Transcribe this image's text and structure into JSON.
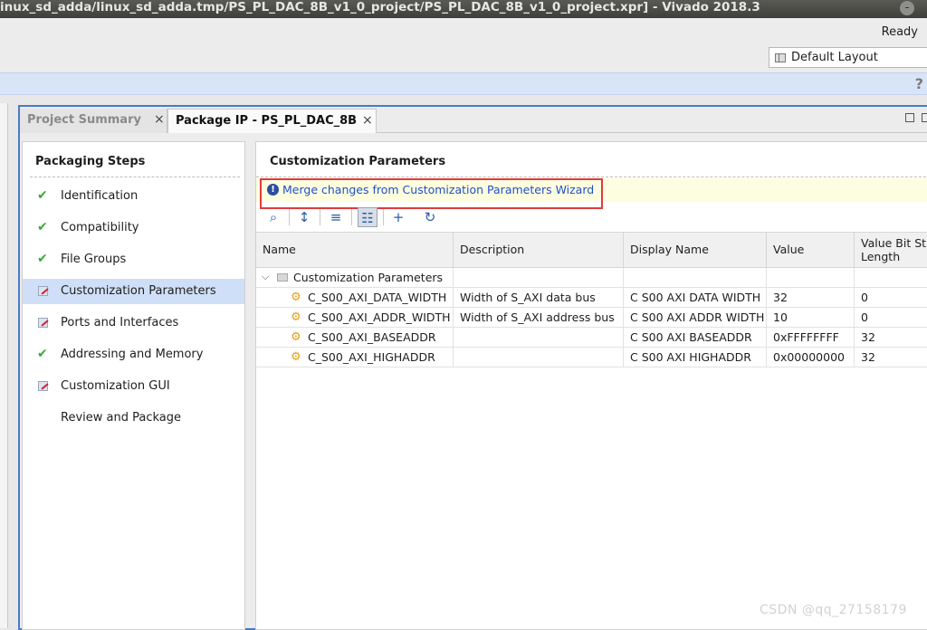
{
  "window": {
    "title": "inux_sd_adda/linux_sd_adda.tmp/PS_PL_DAC_8B_v1_0_project/PS_PL_DAC_8B_v1_0_project.xpr] - Vivado 2018.3"
  },
  "toolbar": {
    "status": "Ready",
    "layout_select": "Default Layout",
    "help_label": "?"
  },
  "tabs": [
    {
      "label": "Project Summary",
      "close": "×"
    },
    {
      "label": "Package IP - PS_PL_DAC_8B",
      "close": "×"
    }
  ],
  "packaging_steps": {
    "title": "Packaging Steps",
    "items": [
      {
        "label": "Identification",
        "status": "complete",
        "icon": "check-icon"
      },
      {
        "label": "Compatibility",
        "status": "complete",
        "icon": "check-icon"
      },
      {
        "label": "File Groups",
        "status": "complete",
        "icon": "check-icon"
      },
      {
        "label": "Customization Parameters",
        "status": "edited",
        "icon": "edit-icon",
        "selected": true
      },
      {
        "label": "Ports and Interfaces",
        "status": "edited",
        "icon": "edit-icon"
      },
      {
        "label": "Addressing and Memory",
        "status": "complete",
        "icon": "check-icon"
      },
      {
        "label": "Customization GUI",
        "status": "edited",
        "icon": "edit-icon"
      },
      {
        "label": "Review and Package",
        "status": "none",
        "icon": ""
      }
    ]
  },
  "customization": {
    "title": "Customization Parameters",
    "info_icon": "!",
    "merge_link": "Merge changes from Customization Parameters Wizard",
    "toolbar_icons": [
      "search-icon",
      "collapse-all-icon",
      "expand-all-icon",
      "hierarchy-icon",
      "add-icon",
      "refresh-icon"
    ],
    "table": {
      "columns": [
        "Name",
        "Description",
        "Display Name",
        "Value",
        "Value Bit St Length"
      ],
      "columns_split": {
        "len_line1": "Value Bit St",
        "len_line2": "Length"
      },
      "group": "Customization Parameters",
      "rows": [
        {
          "name": "C_S00_AXI_DATA_WIDTH",
          "description": "Width of S_AXI data bus",
          "display_name": "C S00 AXI DATA WIDTH",
          "value": "32",
          "length": "0"
        },
        {
          "name": "C_S00_AXI_ADDR_WIDTH",
          "description": "Width of S_AXI address bus",
          "display_name": "C S00 AXI ADDR WIDTH",
          "value": "10",
          "length": "0"
        },
        {
          "name": "C_S00_AXI_BASEADDR",
          "description": "",
          "display_name": "C S00 AXI BASEADDR",
          "value": "0xFFFFFFFF",
          "length": "32"
        },
        {
          "name": "C_S00_AXI_HIGHADDR",
          "description": "",
          "display_name": "C S00 AXI HIGHADDR",
          "value": "0x00000000",
          "length": "32"
        }
      ]
    }
  },
  "watermark": "CSDN @qq_27158179",
  "colors": {
    "accent_blue": "#4a7ac6",
    "highlight_red": "#e03c3c",
    "link_blue": "#2050c8",
    "check_green": "#3aa83a"
  }
}
